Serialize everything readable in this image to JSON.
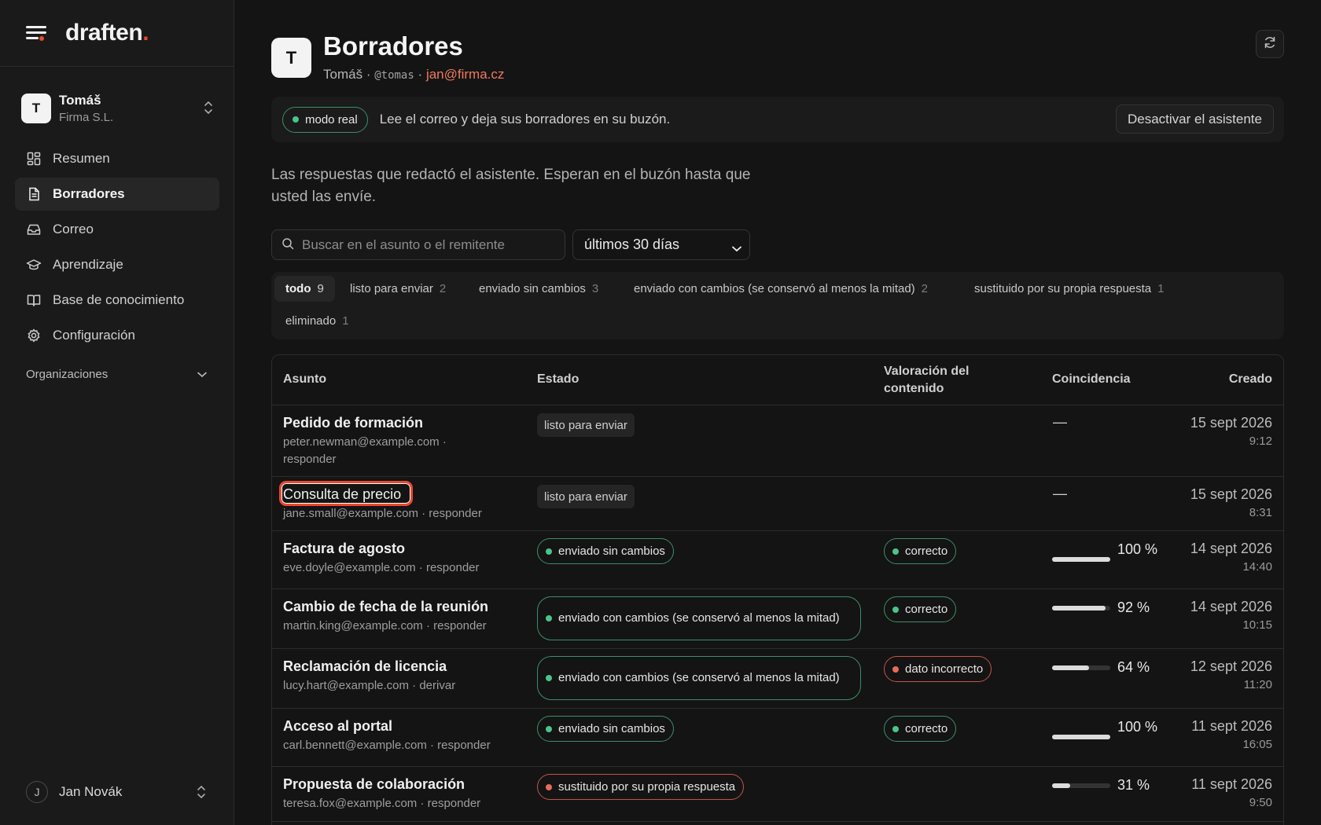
{
  "brand": {
    "name": "draften",
    "dot": "."
  },
  "account": {
    "initial": "T",
    "name": "Tomáš",
    "company": "Firma S.L."
  },
  "nav": [
    {
      "label": "Resumen",
      "icon": "grid-icon"
    },
    {
      "label": "Borradores",
      "icon": "document-icon",
      "active": true
    },
    {
      "label": "Correo",
      "icon": "inbox-icon"
    },
    {
      "label": "Aprendizaje",
      "icon": "graduation-cap-icon"
    },
    {
      "label": "Base de conocimiento",
      "icon": "book-icon"
    },
    {
      "label": "Configuración",
      "icon": "gear-icon"
    }
  ],
  "orgs_label": "Organizaciones",
  "user": {
    "initial": "J",
    "name": "Jan Novák"
  },
  "header": {
    "initial": "T",
    "title": "Borradores",
    "name": "Tomáš",
    "sep": "·",
    "handle": "@tomas",
    "email": "jan@firma.cz"
  },
  "mode": {
    "pill": "modo real",
    "text": "Lee el correo y deja sus borradores en su buzón.",
    "button": "Desactivar el asistente"
  },
  "description": "Las respuestas que redactó el asistente. Esperan en el buzón hasta que usted las envíe.",
  "search": {
    "placeholder": "Buscar en el asunto o el remitente",
    "value": ""
  },
  "period": {
    "selected": "últimos 30 días"
  },
  "filters": [
    {
      "label": "todo",
      "count": "9",
      "active": true
    },
    {
      "label": "listo para enviar",
      "count": "2"
    },
    {
      "label": "enviado sin cambios",
      "count": "3"
    },
    {
      "label": "enviado con cambios (se conservó al menos la mitad)",
      "count": "2"
    },
    {
      "label": "sustituido por su propia respuesta",
      "count": "1"
    },
    {
      "label": "eliminado",
      "count": "1"
    }
  ],
  "table": {
    "headers": {
      "subject": "Asunto",
      "status": "Estado",
      "rating": "Valoración del contenido",
      "match": "Coincidencia",
      "created": "Creado"
    },
    "rows": [
      {
        "subject": "Pedido de formación",
        "from": "peter.newman@example.com · responder",
        "status": "listo para enviar",
        "status_kind": "plain",
        "rating": "",
        "rating_kind": "",
        "match": null,
        "match_text": "—",
        "date": "15 sept 2026",
        "time": "9:12"
      },
      {
        "subject": "Consulta de precio",
        "from": "jane.small@example.com · responder",
        "status": "listo para enviar",
        "status_kind": "plain",
        "rating": "",
        "rating_kind": "",
        "match": null,
        "match_text": "—",
        "date": "15 sept 2026",
        "time": "8:31"
      },
      {
        "subject": "Factura de agosto",
        "from": "eve.doyle@example.com · responder",
        "status": "enviado sin cambios",
        "status_kind": "green",
        "rating": "correcto",
        "rating_kind": "green",
        "match": 100,
        "match_text": "100 %",
        "date": "14 sept 2026",
        "time": "14:40"
      },
      {
        "subject": "Cambio de fecha de la reunión",
        "from": "martin.king@example.com · responder",
        "status": "enviado con cambios (se conservó al menos la mitad)",
        "status_kind": "green",
        "rating": "correcto",
        "rating_kind": "green",
        "match": 92,
        "match_text": "92 %",
        "date": "14 sept 2026",
        "time": "10:15"
      },
      {
        "subject": "Reclamación de licencia",
        "from": "lucy.hart@example.com · derivar",
        "status": "enviado con cambios (se conservó al menos la mitad)",
        "status_kind": "green",
        "rating": "dato incorrecto",
        "rating_kind": "red",
        "match": 64,
        "match_text": "64 %",
        "date": "12 sept 2026",
        "time": "11:20"
      },
      {
        "subject": "Acceso al portal",
        "from": "carl.bennett@example.com · responder",
        "status": "enviado sin cambios",
        "status_kind": "green",
        "rating": "correcto",
        "rating_kind": "green",
        "match": 100,
        "match_text": "100 %",
        "date": "11 sept 2026",
        "time": "16:05"
      },
      {
        "subject": "Propuesta de colaboración",
        "from": "teresa.fox@example.com · responder",
        "status": "sustituido por su propia respuesta",
        "status_kind": "red",
        "rating": "",
        "rating_kind": "",
        "match": 31,
        "match_text": "31 %",
        "date": "11 sept 2026",
        "time": "9:50"
      }
    ]
  },
  "colors": {
    "accent": "#e8492f",
    "green": "#4bc48a",
    "red": "#e86b5a",
    "email": "#ee7a5f"
  }
}
